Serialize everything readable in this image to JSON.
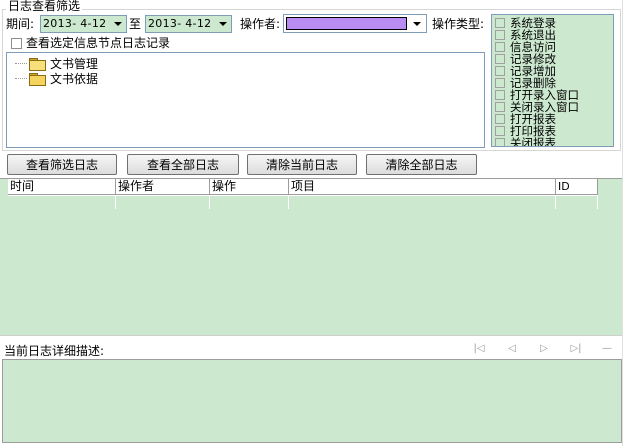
{
  "filter": {
    "group_title": "日志查看筛选",
    "period_label": "期间:",
    "date_from": "2013- 4-12",
    "to_label": "至",
    "date_to": "2013- 4-12",
    "operator_label": "操作者:",
    "operator_color": "#b98cf1",
    "op_type_label": "操作类型:",
    "node_log_checkbox_label": "查看选定信息节点日志记录"
  },
  "tree": {
    "items": [
      {
        "label": "文书管理",
        "icon": "folder-open-icon"
      },
      {
        "label": "文书依据",
        "icon": "folder-icon"
      }
    ]
  },
  "op_types": [
    "系统登录",
    "系统退出",
    "信息访问",
    "记录修改",
    "记录增加",
    "记录删除",
    "打开录入窗口",
    "关闭录入窗口",
    "打开报表",
    "打印报表",
    "关闭报表"
  ],
  "buttons": {
    "view_filtered": "查看筛选日志",
    "view_all": "查看全部日志",
    "clear_current": "清除当前日志",
    "clear_all": "清除全部日志"
  },
  "grid": {
    "columns": [
      "时间",
      "操作者",
      "操作",
      "项目",
      "ID"
    ]
  },
  "detail": {
    "label": "当前日志详细描述:"
  },
  "colors": {
    "panel_green": "#cce8cf",
    "border_blue": "#7f9db9"
  }
}
